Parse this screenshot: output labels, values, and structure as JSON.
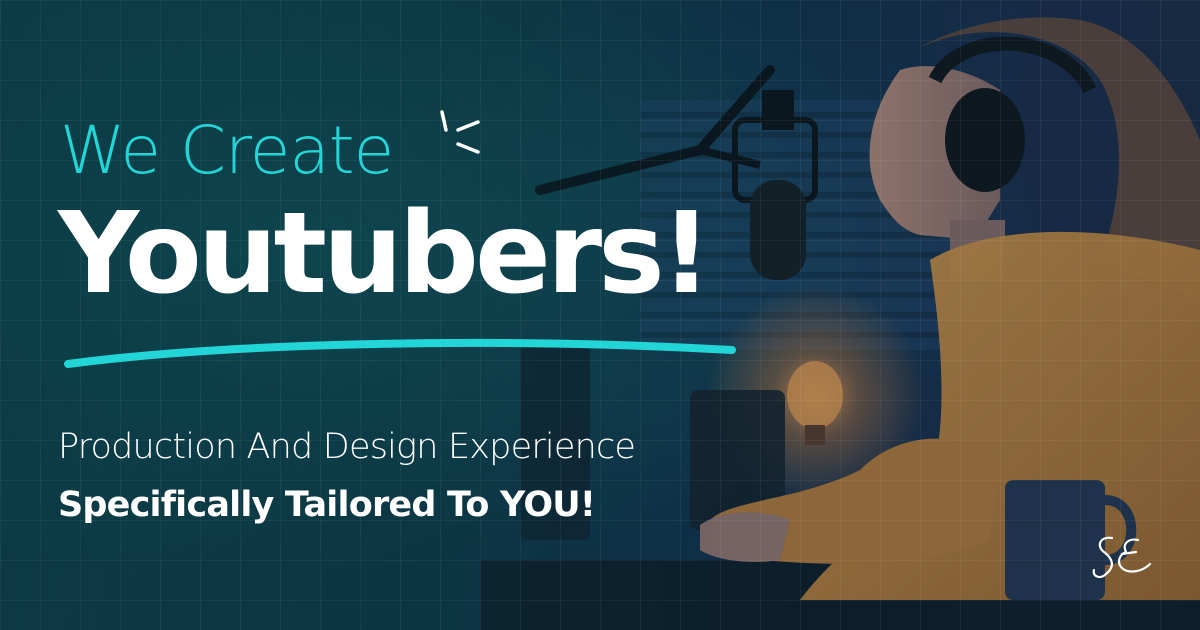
{
  "banner": {
    "headline_line1": "We Create",
    "headline_line2": "Youtubers!",
    "subheadline_line1": "Production And Design Experience",
    "subheadline_line2": "Specifically Tailored To YOU!",
    "logo_text": "SE"
  },
  "colors": {
    "accent": "#22d6d8",
    "text": "#ffffff",
    "background": "#0c3a45",
    "shirt": "#c88a3c"
  },
  "icons": [
    "sparkle-icon",
    "underline-swoosh",
    "se-logo"
  ]
}
